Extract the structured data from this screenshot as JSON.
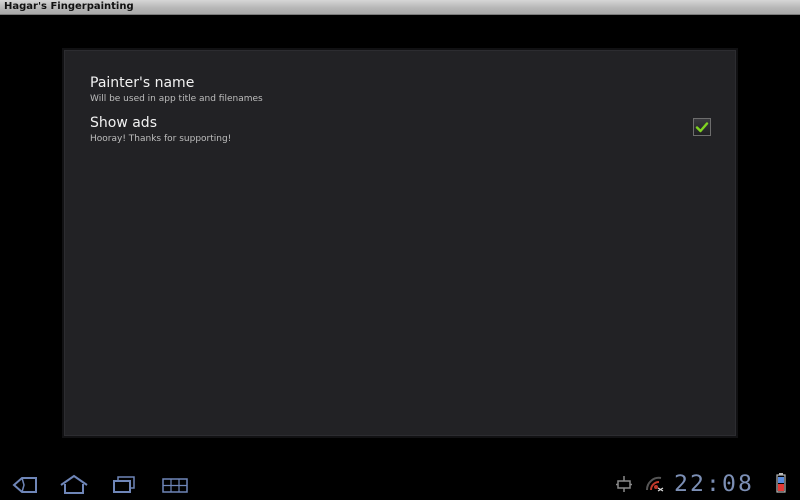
{
  "app": {
    "title": "Hagar's Fingerpainting"
  },
  "preferences": [
    {
      "title": "Painter's name",
      "summary": "Will be used in app title and filenames"
    },
    {
      "title": "Show ads",
      "summary": "Hooray! Thanks for supporting!",
      "checked": true
    }
  ],
  "system_bar": {
    "clock": "22:08",
    "icons": [
      "back-icon",
      "home-icon",
      "recent-apps-icon",
      "menu-icon",
      "usb-debug-icon",
      "signal-icon",
      "battery-icon"
    ]
  },
  "colors": {
    "panel": "#222225",
    "accent_check": "#7fd321",
    "nav_icon": "#6f86b8",
    "clock": "#7c8fb5"
  }
}
